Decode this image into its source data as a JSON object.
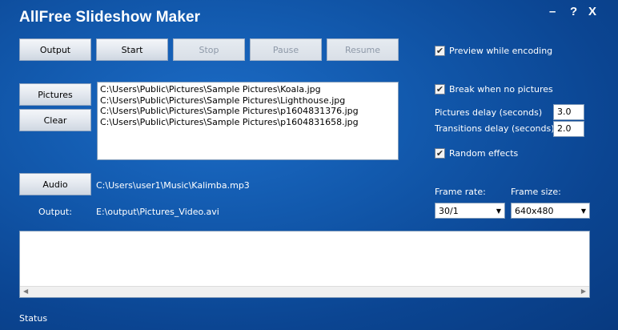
{
  "window": {
    "title": "AllFree Slideshow Maker",
    "minimize": "–",
    "help": "?",
    "close": "X"
  },
  "toolbar": {
    "output": "Output",
    "start": "Start",
    "stop": "Stop",
    "pause": "Pause",
    "resume": "Resume"
  },
  "pictures": {
    "button": "Pictures",
    "clear": "Clear",
    "files": [
      "C:\\Users\\Public\\Pictures\\Sample Pictures\\Koala.jpg",
      "C:\\Users\\Public\\Pictures\\Sample Pictures\\Lighthouse.jpg",
      "C:\\Users\\Public\\Pictures\\Sample Pictures\\p1604831376.jpg",
      "C:\\Users\\Public\\Pictures\\Sample Pictures\\p1604831658.jpg"
    ]
  },
  "audio": {
    "button": "Audio",
    "path": "C:\\Users\\user1\\Music\\Kalimba.mp3"
  },
  "output": {
    "label": "Output:",
    "path": "E:\\output\\Pictures_Video.avi"
  },
  "options": {
    "preview_label": "Preview while encoding",
    "preview_checked": true,
    "break_label": "Break when no pictures",
    "break_checked": true,
    "pictures_delay_label": "Pictures delay (seconds)",
    "pictures_delay_value": "3.0",
    "transitions_delay_label": "Transitions delay (seconds)",
    "transitions_delay_value": "2.0",
    "random_label": "Random effects",
    "random_checked": true,
    "frame_rate_label": "Frame rate:",
    "frame_rate_value": "30/1",
    "frame_size_label": "Frame size:",
    "frame_size_value": "640x480"
  },
  "status": {
    "text": "Status"
  },
  "icons": {
    "check": "✔",
    "dropdown": "▼",
    "scroll_left": "◀",
    "scroll_right": "▶"
  }
}
